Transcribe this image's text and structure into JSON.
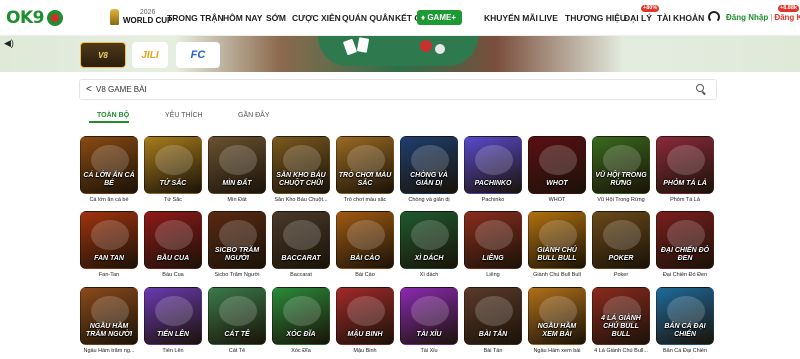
{
  "header": {
    "logo": "OK9",
    "world_cup": {
      "year": "2026",
      "name": "WORLD CUP"
    },
    "nav": [
      {
        "label": "TRONG TRẬN"
      },
      {
        "label": "HÔM NAY"
      },
      {
        "label": "SỚM"
      },
      {
        "label": "CƯỢC XIÊN"
      },
      {
        "label": "QUÁN QUÂN"
      },
      {
        "label": "KẾT QUẢ"
      }
    ],
    "game_button": "GAME+",
    "nav_right": [
      {
        "label": "KHUYẾN MÃI"
      },
      {
        "label": "LIVE"
      },
      {
        "label": "THƯƠNG HIỆU"
      },
      {
        "label": "ĐẠI LÝ"
      },
      {
        "label": "TÀI KHOẢN"
      }
    ],
    "dai_ly_badge": "+80%",
    "tai_khoan_badge": "+8.88k",
    "login": "Đăng Nhập",
    "separator": "|",
    "register": "Đăng Ký"
  },
  "banner": {
    "providers": [
      {
        "name": "V8 GAMING",
        "short": "V8"
      },
      {
        "name": "JILI",
        "short": "JILI"
      },
      {
        "name": "FC",
        "short": "FC"
      }
    ]
  },
  "search": {
    "back": "<",
    "title": "V8 GAME BÀI"
  },
  "tabs": [
    {
      "label": "TOÀN BỘ",
      "active": true
    },
    {
      "label": "YÊU THÍCH",
      "active": false
    },
    {
      "label": "GẦN ĐÂY",
      "active": false
    }
  ],
  "games": [
    {
      "label": "CÁ LỚN ĂN CÁ BÉ",
      "caption": "Cá lớn ăn cá bé",
      "color": "#8a4a12"
    },
    {
      "label": "TỨ SẮC",
      "caption": "Tứ Sắc",
      "color": "#a77d1c"
    },
    {
      "label": "MÌN ĐẤT",
      "caption": "Mìn Đất",
      "color": "#6a5232"
    },
    {
      "label": "SĂN KHO BÁU CHUỘT CHŨI",
      "caption": "Săn Kho Báu Chuột...",
      "color": "#7a5a1e"
    },
    {
      "label": "TRÒ CHƠI MÀU SẮC",
      "caption": "Trò chơi màu sắc",
      "color": "#9a6a22"
    },
    {
      "label": "CHÒNG VÀ GIẢN DỊ",
      "caption": "Chòng và giản dị",
      "color": "#1e3e6e"
    },
    {
      "label": "PACHINKO",
      "caption": "Pachinko",
      "color": "#5a4acb"
    },
    {
      "label": "WHOT",
      "caption": "WHOT",
      "color": "#5a0f14"
    },
    {
      "label": "VŨ HỘI TRONG RỪNG",
      "caption": "Vũ Hội Trong Rừng",
      "color": "#3a6a1e"
    },
    {
      "label": "PHỎM TÁ LẢ",
      "caption": "Phỏm Tá Lả",
      "color": "#8a2a3a"
    },
    {
      "label": "FAN TAN",
      "caption": "Fan-Tan",
      "color": "#a0340e"
    },
    {
      "label": "BẦU CUA",
      "caption": "Bầu Cua",
      "color": "#8e1a1a"
    },
    {
      "label": "SICBO TRĂM NGƯỜI",
      "caption": "Sicbo Trăm Người",
      "color": "#5a2a12"
    },
    {
      "label": "BACCARAT",
      "caption": "Baccarat",
      "color": "#4a3a2a"
    },
    {
      "label": "BÀI CÀO",
      "caption": "Bài Cào",
      "color": "#a05a12"
    },
    {
      "label": "XÌ DÁCH",
      "caption": "Xì dách",
      "color": "#1e5a2e"
    },
    {
      "label": "LIÊNG",
      "caption": "Liêng",
      "color": "#8a2e1e"
    },
    {
      "label": "GIÀNH CHỦ BULL BULL",
      "caption": "Giành Chủ Bull Bull",
      "color": "#b0700e"
    },
    {
      "label": "POKER",
      "caption": "Poker",
      "color": "#6a4a1a"
    },
    {
      "label": "ĐẠI CHIẾN ĐỎ ĐEN",
      "caption": "Đại Chiến Đỏ Đen",
      "color": "#7a1e1e"
    },
    {
      "label": "NGẦU HẦM TRĂM NGƯỜI",
      "caption": "Ngầu Hầm trăm ng...",
      "color": "#8a4a1a"
    },
    {
      "label": "TIẾN LÊN",
      "caption": "Tiến Lên",
      "color": "#6a3ab0"
    },
    {
      "label": "CÁT TÊ",
      "caption": "Cát Tê",
      "color": "#3a7a4a"
    },
    {
      "label": "XÓC ĐĨA",
      "caption": "Xóc Đĩa",
      "color": "#2a8a3a"
    },
    {
      "label": "MẬU BINH",
      "caption": "Mậu Binh",
      "color": "#a02a2a"
    },
    {
      "label": "TÀI XỈU",
      "caption": "Tài Xỉu",
      "color": "#8a2ab0"
    },
    {
      "label": "BÀI TẤN",
      "caption": "Bài Tấn",
      "color": "#5a3a2a"
    },
    {
      "label": "NGẦU HẦM XEM BÀI",
      "caption": "Ngầu Hầm xem bài",
      "color": "#b0701a"
    },
    {
      "label": "4 LÁ GIÀNH CHỦ BULL BULL",
      "caption": "4 Lá Giành Chủ Bull...",
      "color": "#8a2a1e"
    },
    {
      "label": "BẮN CÁ ĐẠI CHIẾN",
      "caption": "Bắn Cá Đại Chiến",
      "color": "#1e6a9a"
    }
  ]
}
